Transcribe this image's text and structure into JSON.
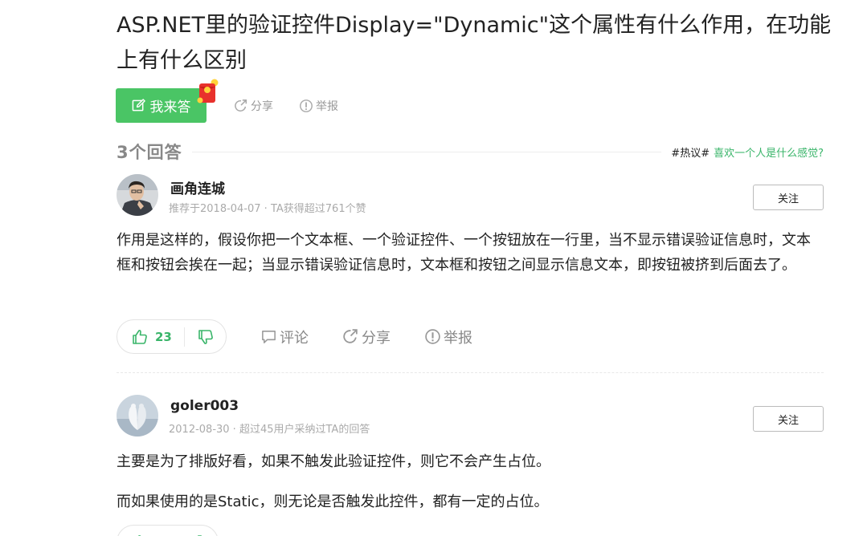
{
  "question": {
    "title": "ASP.NET里的验证控件Display=\"Dynamic\"这个属性有什么作用，在功能上有什么区别",
    "answer_button": "我来答",
    "share": "分享",
    "report": "举报"
  },
  "answers_header": {
    "count_label": "3个回答",
    "hot_tag": "#热议#",
    "hot_topic": "喜欢一个人是什么感觉?"
  },
  "answers": [
    {
      "author": "画角连城",
      "meta": "推荐于2018-04-07 · TA获得超过761个赞",
      "follow": "关注",
      "paragraphs": [
        "作用是这样的，假设你把一个文本框、一个验证控件、一个按钮放在一行里，当不显示错误验证信息时，文本框和按钮会挨在一起；当显示错误验证信息时，文本框和按钮之间显示信息文本，即按钮被挤到后面去了。"
      ],
      "likes": "23",
      "comment": "评论",
      "share": "分享",
      "report": "举报"
    },
    {
      "author": "goler003",
      "meta": "2012-08-30 · 超过45用户采纳过TA的回答",
      "follow": "关注",
      "paragraphs": [
        "主要是为了排版好看，如果不触发此验证控件，则它不会产生占位。",
        "而如果使用的是Static，则无论是否触发此控件，都有一定的占位。"
      ]
    }
  ],
  "colors": {
    "accent_green": "#4ac565",
    "link_green": "#3ab56a",
    "muted_text": "#999999"
  },
  "icons": [
    "edit-icon",
    "red-packet-icon",
    "share-icon",
    "report-icon",
    "thumb-up-icon",
    "thumb-down-icon",
    "comment-icon"
  ]
}
